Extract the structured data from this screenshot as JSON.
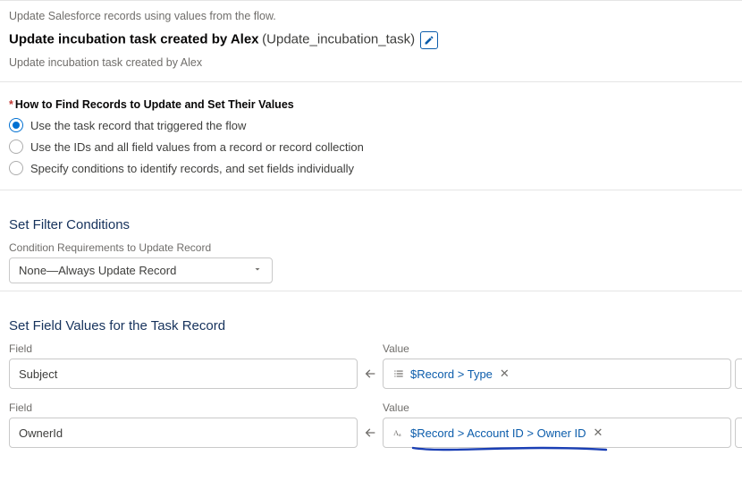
{
  "intro": {
    "description": "Update Salesforce records using values from the flow.",
    "title": "Update incubation task created by Alex",
    "api_name": "(Update_incubation_task)",
    "subtitle": "Update incubation task created by Alex"
  },
  "find": {
    "heading": "How to Find Records to Update and Set Their Values",
    "options": [
      {
        "label": "Use the task record that triggered the flow",
        "selected": true
      },
      {
        "label": "Use the IDs and all field values from a record or record collection",
        "selected": false
      },
      {
        "label": "Specify conditions to identify records, and set fields individually",
        "selected": false
      }
    ]
  },
  "filter": {
    "heading": "Set Filter Conditions",
    "requirements_label": "Condition Requirements to Update Record",
    "requirements_value": "None—Always Update Record"
  },
  "setValues": {
    "heading": "Set Field Values for the Task Record",
    "field_label": "Field",
    "value_label": "Value",
    "rows": [
      {
        "field": "Subject",
        "icon": "list",
        "value_ref": "$Record > Type"
      },
      {
        "field": "OwnerId",
        "icon": "text",
        "value_ref": "$Record > Account ID > Owner ID"
      }
    ]
  }
}
